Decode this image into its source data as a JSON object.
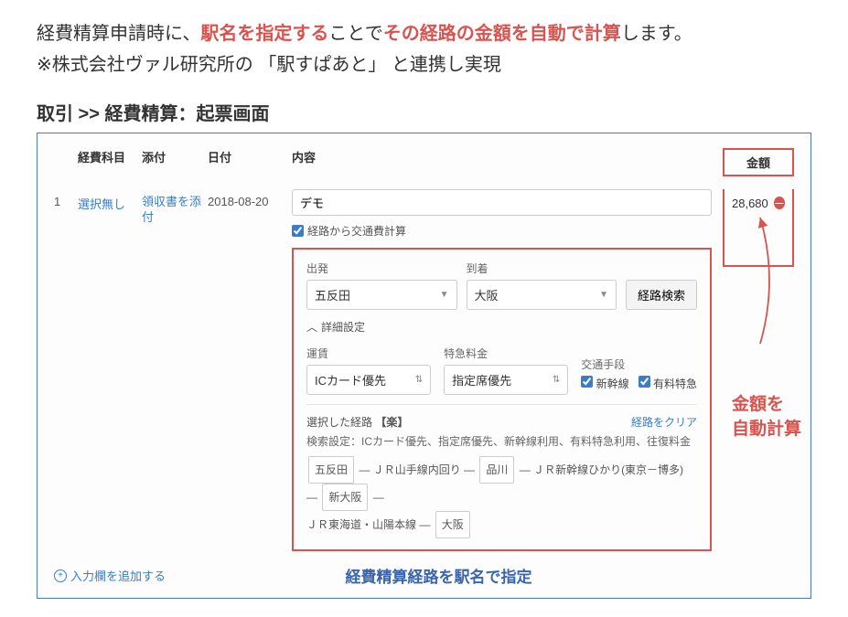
{
  "intro": {
    "p1a": "経費精算申請時に、",
    "p1b": "駅名を指定する",
    "p1c": "ことで",
    "p1d": "その経路の金額を自動で計算",
    "p1e": "します。",
    "p2": "※株式会社ヴァル研究所の 「駅すぱあと」 と連携し実現"
  },
  "section_title": "取引 >> 経費精算：起票画面",
  "headers": {
    "account": "経費科目",
    "attach": "添付",
    "date": "日付",
    "content": "内容",
    "amount": "金額"
  },
  "row": {
    "num": "1",
    "account": "選択無し",
    "attach": "領収書を添付",
    "date": "2018-08-20",
    "content_value": "デモ",
    "checkbox_label": "経路から交通費計算",
    "amount": "28,680"
  },
  "route": {
    "departure_label": "出発",
    "departure_value": "五反田",
    "arrival_label": "到着",
    "arrival_value": "大阪",
    "search_btn": "経路検索",
    "detail_toggle": "詳細設定",
    "fare_label": "運賃",
    "fare_value": "ICカード優先",
    "express_label": "特急料金",
    "express_value": "指定席優先",
    "transport_label": "交通手段",
    "opt_shinkansen": "新幹線",
    "opt_express": "有料特急",
    "selected_label": "選択した経路",
    "raku": "【楽】",
    "clear": "経路をクリア",
    "settings_prefix": "検索設定：",
    "settings": "ICカード優先、指定席優先、新幹線利用、有料特急利用、往復料金",
    "path": {
      "s1": "五反田",
      "l1": "ＪＲ山手線内回り",
      "s2": "品川",
      "l2": "ＪＲ新幹線ひかり(東京－博多)",
      "s3": "新大阪",
      "l3": "ＪＲ東海道・山陽本線",
      "s4": "大阪"
    }
  },
  "add_row": "入力欄を追加する",
  "caption": "経費精算経路を駅名で指定",
  "annotation_l1": "金額を",
  "annotation_l2": "自動計算"
}
